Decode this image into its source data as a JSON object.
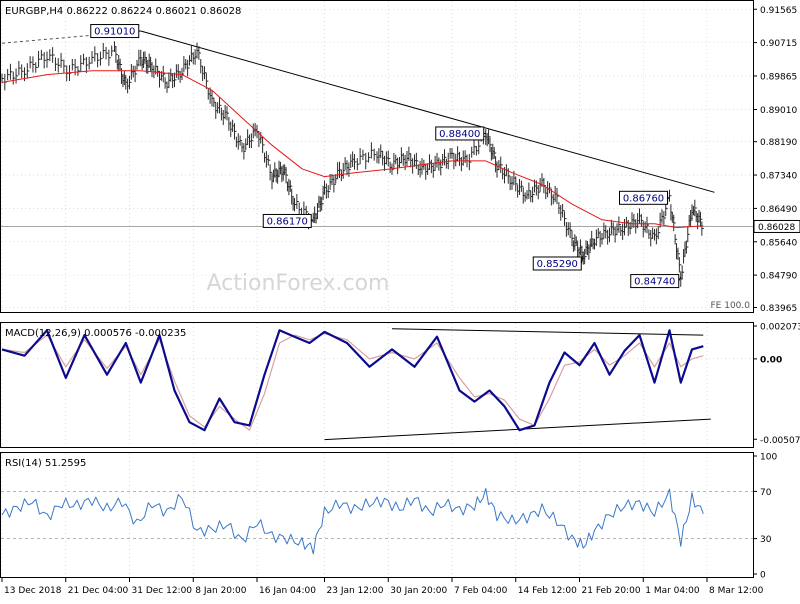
{
  "chart_data": {
    "type": "line",
    "main": {
      "header": "EURGBP,H4  0.86222 0.86224 0.86021 0.86028",
      "watermark": "ActionForex.com",
      "fe_label": "FE 100.0",
      "last_price": "0.86028",
      "ylim": [
        0.8385,
        0.9175
      ],
      "ticks": [
        "0.91565",
        "0.90715",
        "0.89865",
        "0.89010",
        "0.88190",
        "0.87340",
        "0.86490",
        "0.85640",
        "0.84790",
        "0.83965"
      ],
      "tick_values": [
        0.91565,
        0.90715,
        0.89865,
        0.8901,
        0.8819,
        0.8734,
        0.8649,
        0.8564,
        0.8479,
        0.83965
      ],
      "callouts": [
        {
          "label": "0.91010",
          "x": 0.185,
          "y": 0.9101
        },
        {
          "label": "0.86170",
          "x": 0.415,
          "y": 0.8617
        },
        {
          "label": "0.88400",
          "x": 0.645,
          "y": 0.884
        },
        {
          "label": "0.85290",
          "x": 0.775,
          "y": 0.8529
        },
        {
          "label": "0.86760",
          "x": 0.89,
          "y": 0.8676
        },
        {
          "label": "0.84740",
          "x": 0.905,
          "y": 0.8474
        }
      ],
      "close_x": [
        0.0,
        0.03,
        0.06,
        0.09,
        0.12,
        0.15,
        0.165,
        0.185,
        0.2,
        0.22,
        0.24,
        0.26,
        0.28,
        0.3,
        0.32,
        0.34,
        0.36,
        0.375,
        0.39,
        0.415,
        0.43,
        0.45,
        0.47,
        0.5,
        0.52,
        0.54,
        0.56,
        0.58,
        0.6,
        0.62,
        0.645,
        0.66,
        0.68,
        0.7,
        0.72,
        0.74,
        0.76,
        0.775,
        0.79,
        0.81,
        0.83,
        0.85,
        0.87,
        0.89,
        0.905,
        0.92,
        0.935
      ],
      "close": [
        0.898,
        0.9,
        0.904,
        0.9,
        0.903,
        0.905,
        0.896,
        0.903,
        0.901,
        0.897,
        0.9,
        0.905,
        0.892,
        0.888,
        0.88,
        0.885,
        0.873,
        0.875,
        0.866,
        0.8617,
        0.869,
        0.874,
        0.877,
        0.879,
        0.876,
        0.878,
        0.875,
        0.876,
        0.878,
        0.877,
        0.884,
        0.876,
        0.872,
        0.868,
        0.871,
        0.867,
        0.857,
        0.8529,
        0.857,
        0.859,
        0.86,
        0.862,
        0.857,
        0.8676,
        0.8474,
        0.865,
        0.8603
      ],
      "ma_x": [
        0.0,
        0.06,
        0.12,
        0.185,
        0.24,
        0.28,
        0.32,
        0.36,
        0.4,
        0.43,
        0.47,
        0.52,
        0.56,
        0.6,
        0.645,
        0.68,
        0.72,
        0.76,
        0.8,
        0.84,
        0.87,
        0.9,
        0.935
      ],
      "ma": [
        0.897,
        0.899,
        0.9,
        0.9,
        0.899,
        0.895,
        0.888,
        0.881,
        0.875,
        0.873,
        0.874,
        0.875,
        0.876,
        0.877,
        0.877,
        0.874,
        0.871,
        0.866,
        0.862,
        0.861,
        0.861,
        0.86,
        0.8605
      ],
      "trendline": {
        "x": [
          0.185,
          0.95
        ],
        "y": [
          0.9101,
          0.869
        ]
      },
      "dashline": {
        "x": [
          0.0,
          0.185
        ],
        "y": [
          0.907,
          0.9101
        ]
      }
    },
    "macd": {
      "header": "MACD(12,26,9) 0.000576 -0.000235",
      "ylim": [
        -0.0055,
        0.0022
      ],
      "ticks": [
        "0.002073",
        "0.00",
        "-0.005074"
      ],
      "tick_values": [
        0.002073,
        0.0,
        -0.005074
      ],
      "x": [
        0.0,
        0.03,
        0.06,
        0.085,
        0.11,
        0.14,
        0.165,
        0.185,
        0.21,
        0.23,
        0.25,
        0.27,
        0.29,
        0.31,
        0.33,
        0.35,
        0.37,
        0.39,
        0.41,
        0.43,
        0.46,
        0.49,
        0.52,
        0.55,
        0.58,
        0.61,
        0.63,
        0.65,
        0.67,
        0.69,
        0.71,
        0.73,
        0.75,
        0.77,
        0.79,
        0.81,
        0.83,
        0.85,
        0.87,
        0.89,
        0.905,
        0.92,
        0.935
      ],
      "macd": [
        0.0006,
        0.0002,
        0.0018,
        -0.0012,
        0.0015,
        -0.001,
        0.001,
        -0.0015,
        0.0015,
        -0.002,
        -0.004,
        -0.0045,
        -0.0025,
        -0.004,
        -0.0042,
        -0.001,
        0.0018,
        0.0014,
        0.001,
        0.0017,
        0.001,
        -0.0005,
        0.0006,
        -0.0005,
        0.0014,
        -0.002,
        -0.0027,
        -0.002,
        -0.003,
        -0.0045,
        -0.0042,
        -0.0015,
        0.0004,
        -0.0004,
        0.001,
        -0.001,
        0.0005,
        0.0015,
        -0.0015,
        0.0018,
        -0.0015,
        0.0006,
        0.0008
      ],
      "signal": [
        0.0006,
        0.0004,
        0.0015,
        -0.0005,
        0.0012,
        -0.0006,
        0.0008,
        -0.001,
        0.0012,
        -0.0014,
        -0.0036,
        -0.0043,
        -0.003,
        -0.0038,
        -0.0045,
        -0.0022,
        0.001,
        0.0015,
        0.0012,
        0.0016,
        0.0012,
        0.0,
        0.0004,
        0.0,
        0.001,
        -0.0012,
        -0.0024,
        -0.0022,
        -0.0026,
        -0.0038,
        -0.0042,
        -0.0025,
        -0.0004,
        -0.0002,
        0.0006,
        -0.0004,
        0.0002,
        0.001,
        -0.0005,
        0.001,
        -0.0005,
        0.0,
        0.0002
      ],
      "upper_line": {
        "x": [
          0.52,
          0.935
        ],
        "y": [
          0.0019,
          0.0015
        ]
      },
      "lower_line": {
        "x": [
          0.43,
          0.945
        ],
        "y": [
          -0.0051,
          -0.0038
        ]
      }
    },
    "rsi": {
      "header": "RSI(14) 51.2595",
      "ylim": [
        0,
        100
      ],
      "ticks": [
        "100",
        "70",
        "30",
        "0"
      ],
      "tick_values": [
        100,
        70,
        30,
        0
      ],
      "levels": [
        70,
        30
      ],
      "x": [
        0.0,
        0.02,
        0.04,
        0.06,
        0.08,
        0.1,
        0.12,
        0.14,
        0.16,
        0.18,
        0.2,
        0.22,
        0.24,
        0.26,
        0.28,
        0.3,
        0.32,
        0.34,
        0.36,
        0.38,
        0.4,
        0.415,
        0.43,
        0.45,
        0.47,
        0.49,
        0.51,
        0.53,
        0.55,
        0.57,
        0.59,
        0.61,
        0.63,
        0.645,
        0.66,
        0.68,
        0.7,
        0.72,
        0.74,
        0.76,
        0.775,
        0.79,
        0.81,
        0.83,
        0.85,
        0.87,
        0.89,
        0.905,
        0.92,
        0.935
      ],
      "values": [
        50,
        56,
        62,
        48,
        60,
        58,
        63,
        55,
        62,
        42,
        60,
        52,
        66,
        36,
        38,
        42,
        28,
        44,
        32,
        30,
        26,
        22,
        52,
        60,
        55,
        60,
        62,
        55,
        64,
        52,
        60,
        54,
        58,
        68,
        50,
        45,
        48,
        55,
        45,
        30,
        24,
        36,
        50,
        58,
        60,
        52,
        68,
        28,
        64,
        51
      ]
    },
    "xaxis": {
      "labels": [
        "13 Dec 2018",
        "21 Dec 04:00",
        "31 Dec 12:00",
        "8 Jan 20:00",
        "16 Jan 04:00",
        "23 Jan 12:00",
        "30 Jan 20:00",
        "7 Feb 04:00",
        "14 Feb 12:00",
        "21 Feb 20:00",
        "1 Mar 04:00",
        "8 Mar 12:00"
      ],
      "positions": [
        0.0,
        0.085,
        0.17,
        0.255,
        0.34,
        0.43,
        0.515,
        0.6,
        0.685,
        0.77,
        0.855,
        0.94
      ]
    },
    "colors": {
      "price": "#2a2a2a",
      "ma": "#e31a1c",
      "macd": "#0b0b8f",
      "signal": "#d9a0a0",
      "rsi": "#3b78c8",
      "trend": "#000000",
      "grid": "#c8c8c8",
      "watermark": "#d9d9d9",
      "callout_text": "#000080"
    }
  }
}
